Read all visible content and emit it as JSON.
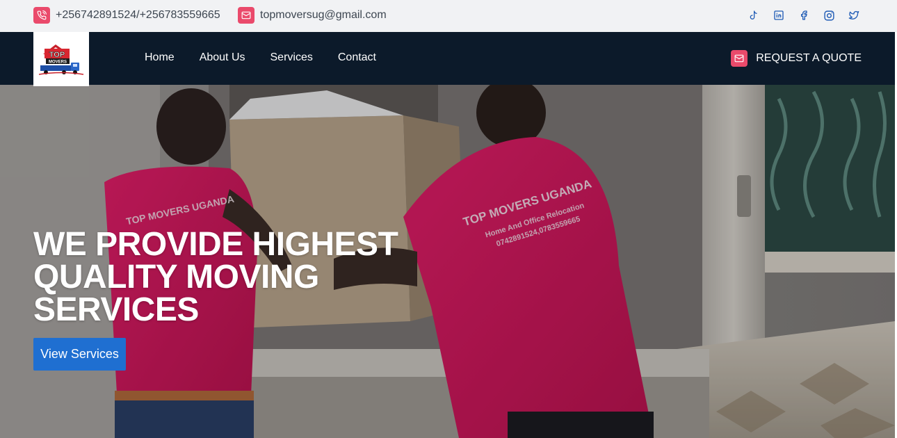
{
  "topbar": {
    "phone": {
      "text": "+256742891524/+256783559665",
      "icon": "phone-icon"
    },
    "email": {
      "text": "topmoversug@gmail.com",
      "icon": "mail-icon"
    },
    "socials": [
      "tiktok-icon",
      "linkedin-icon",
      "facebook-icon",
      "instagram-icon",
      "twitter-icon"
    ]
  },
  "navbar": {
    "logo": {
      "line1": "TOP",
      "line2": "MOVERS"
    },
    "links": [
      "Home",
      "About Us",
      "Services",
      "Contact"
    ],
    "quote_label": "REQUEST A QUOTE"
  },
  "hero": {
    "title": "WE PROVIDE HIGHEST QUALITY MOVING SERVICES",
    "button_label": "View Services",
    "shirt_text": {
      "line1": "TOP MOVERS UGANDA",
      "line2": "Home And Office Relocation",
      "line3": "0742891524,0783559665"
    }
  },
  "colors": {
    "accent": "#ea4a6b",
    "navbar_bg": "#0c1a2a",
    "button_bg": "#1f6fd1",
    "social_icon": "#1f5bb5"
  }
}
